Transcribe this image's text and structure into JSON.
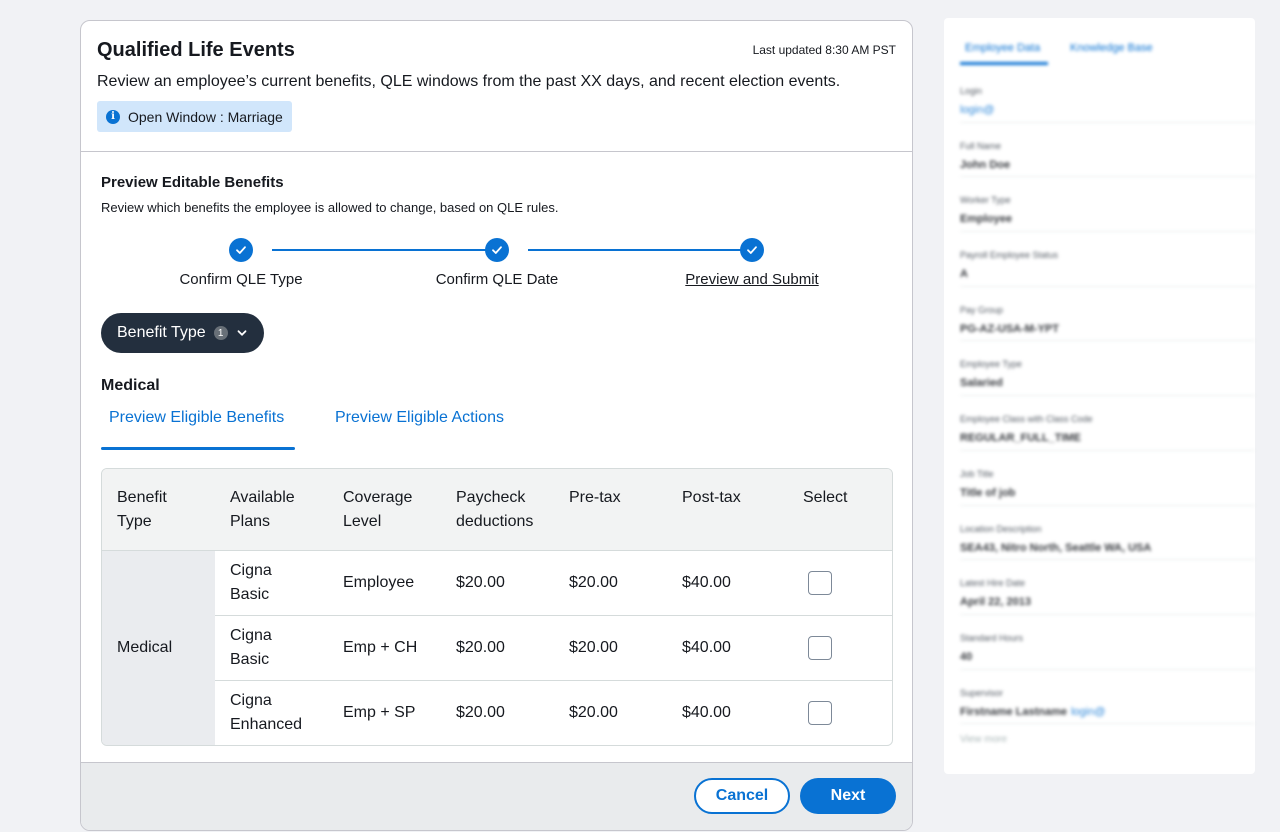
{
  "header": {
    "title": "Qualified Life Events",
    "last_updated": "Last updated 8:30 AM PST",
    "description": "Review an employee’s current benefits, QLE windows from the past XX days, and recent election events.",
    "window_badge": "Open Window : Marriage"
  },
  "preview": {
    "title": "Preview Editable Benefits",
    "description": "Review which benefits the employee is allowed to change, based on QLE rules."
  },
  "stepper": {
    "steps": [
      {
        "label": "Confirm QLE Type",
        "state": "complete"
      },
      {
        "label": "Confirm QLE Date",
        "state": "complete"
      },
      {
        "label": "Preview and Submit",
        "state": "active"
      }
    ],
    "accent": "#0972d3"
  },
  "benefit_type_button": {
    "label": "Benefit Type",
    "count": "1"
  },
  "group_title": "Medical",
  "tabs": [
    {
      "label": "Preview Eligible Benefits",
      "selected": true
    },
    {
      "label": "Preview Eligible Actions",
      "selected": false
    }
  ],
  "table": {
    "headers": [
      "Benefit Type",
      "Available Plans",
      "Coverage Level",
      "Paycheck deductions",
      "Pre-tax",
      "Post-tax",
      "Select"
    ],
    "group_label": "Medical",
    "rows": [
      {
        "plan": "Cigna Basic",
        "coverage": "Employee",
        "paycheck": "$20.00",
        "pretax": "$20.00",
        "posttax": "$40.00",
        "selected": false
      },
      {
        "plan": "Cigna Basic",
        "coverage": "Emp + CH",
        "paycheck": "$20.00",
        "pretax": "$20.00",
        "posttax": "$40.00",
        "selected": false
      },
      {
        "plan": "Cigna Enhanced",
        "coverage": "Emp + SP",
        "paycheck": "$20.00",
        "pretax": "$20.00",
        "posttax": "$40.00",
        "selected": false
      }
    ]
  },
  "footer": {
    "cancel": "Cancel",
    "next": "Next"
  },
  "side_panel": {
    "tabs": [
      "Employee Data",
      "Knowledge Base"
    ],
    "fields": [
      {
        "label": "Login",
        "value": "login@",
        "link": true
      },
      {
        "label": "Full Name",
        "value": "John Doe"
      },
      {
        "label": "Worker Type",
        "value": "Employee"
      },
      {
        "label": "Payroll Employee Status",
        "value": "A"
      },
      {
        "label": "Pay Group",
        "value": "PG-AZ-USA-M-YPT"
      },
      {
        "label": "Employee Type",
        "value": "Salaried"
      },
      {
        "label": "Employee Class with Class Code",
        "value": "REGULAR_FULL_TIME"
      },
      {
        "label": "Job Title",
        "value": "Title of job"
      },
      {
        "label": "Location Description",
        "value": "SEA43, Nitro North, Seattle WA, USA"
      },
      {
        "label": "Latest Hire Date",
        "value": "April 22, 2013"
      },
      {
        "label": "Standard Hours",
        "value": "40"
      },
      {
        "label": "Supervisor",
        "value": "Firstname Lastname",
        "link_text": "login@"
      }
    ],
    "view_more": "View more"
  }
}
